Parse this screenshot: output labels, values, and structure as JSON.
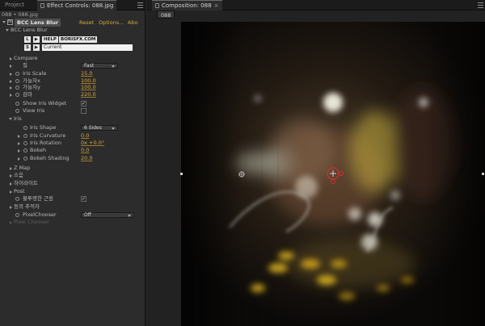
{
  "left_panel": {
    "tabs": {
      "project": "Project",
      "effect_controls": "Effect Controls: 088.jpg"
    },
    "subpath": "088 • 088.jpg",
    "effect": {
      "name": "BCC Lens Blur",
      "reset": "Reset",
      "options": "Options...",
      "about": "Abo",
      "preset_label": "BCC Lens Blur",
      "help_label": "HELP",
      "url_label": "BORISFX.COM",
      "current_preset": "Current",
      "L_label": "L",
      "S_label": "S"
    },
    "rows": {
      "compare": "Compare",
      "quality_label": "질",
      "quality_value": "Fast",
      "iris_scale_label": "Iris Scale",
      "iris_scale_value": "15.0",
      "aspect_x_label": "가늘자x",
      "aspect_x_value": "100.0",
      "aspect_y_label": "가늘자y",
      "aspect_y_value": "100.0",
      "gain_label": "감마",
      "gain_value": "220.0",
      "show_iris_widget": "Show Iris Widget",
      "view_iris": "View Iris",
      "iris_group": "Iris",
      "iris_shape_label": "Iris Shape",
      "iris_shape_value": "6 Sides",
      "iris_curvature_label": "Iris Curvature",
      "iris_curvature_value": "0.0",
      "iris_rotation_label": "Iris Rotation",
      "iris_rotation_value": "0x +0.0°",
      "bokeh_label": "Bokeh",
      "bokeh_value": "0.0",
      "bokeh_shading_label": "Bokeh Shading",
      "bokeh_shading_value": "20.0",
      "z_map": "Z Map",
      "noise": "소음",
      "highlight": "하이라이트",
      "post": "Post",
      "opaque_label": "불투명한 근원",
      "motion_tracker": "동의 추적자",
      "pixel_chooser_label": "PixelChooser",
      "pixel_chooser_value": "Off",
      "pixel_chooser_dim": "Pixel Chooser"
    }
  },
  "right_panel": {
    "tab": "Composition: 088",
    "sub_tab": "088"
  },
  "colors": {
    "accent_value": "#d9a93a",
    "widget_red": "#d03030"
  }
}
